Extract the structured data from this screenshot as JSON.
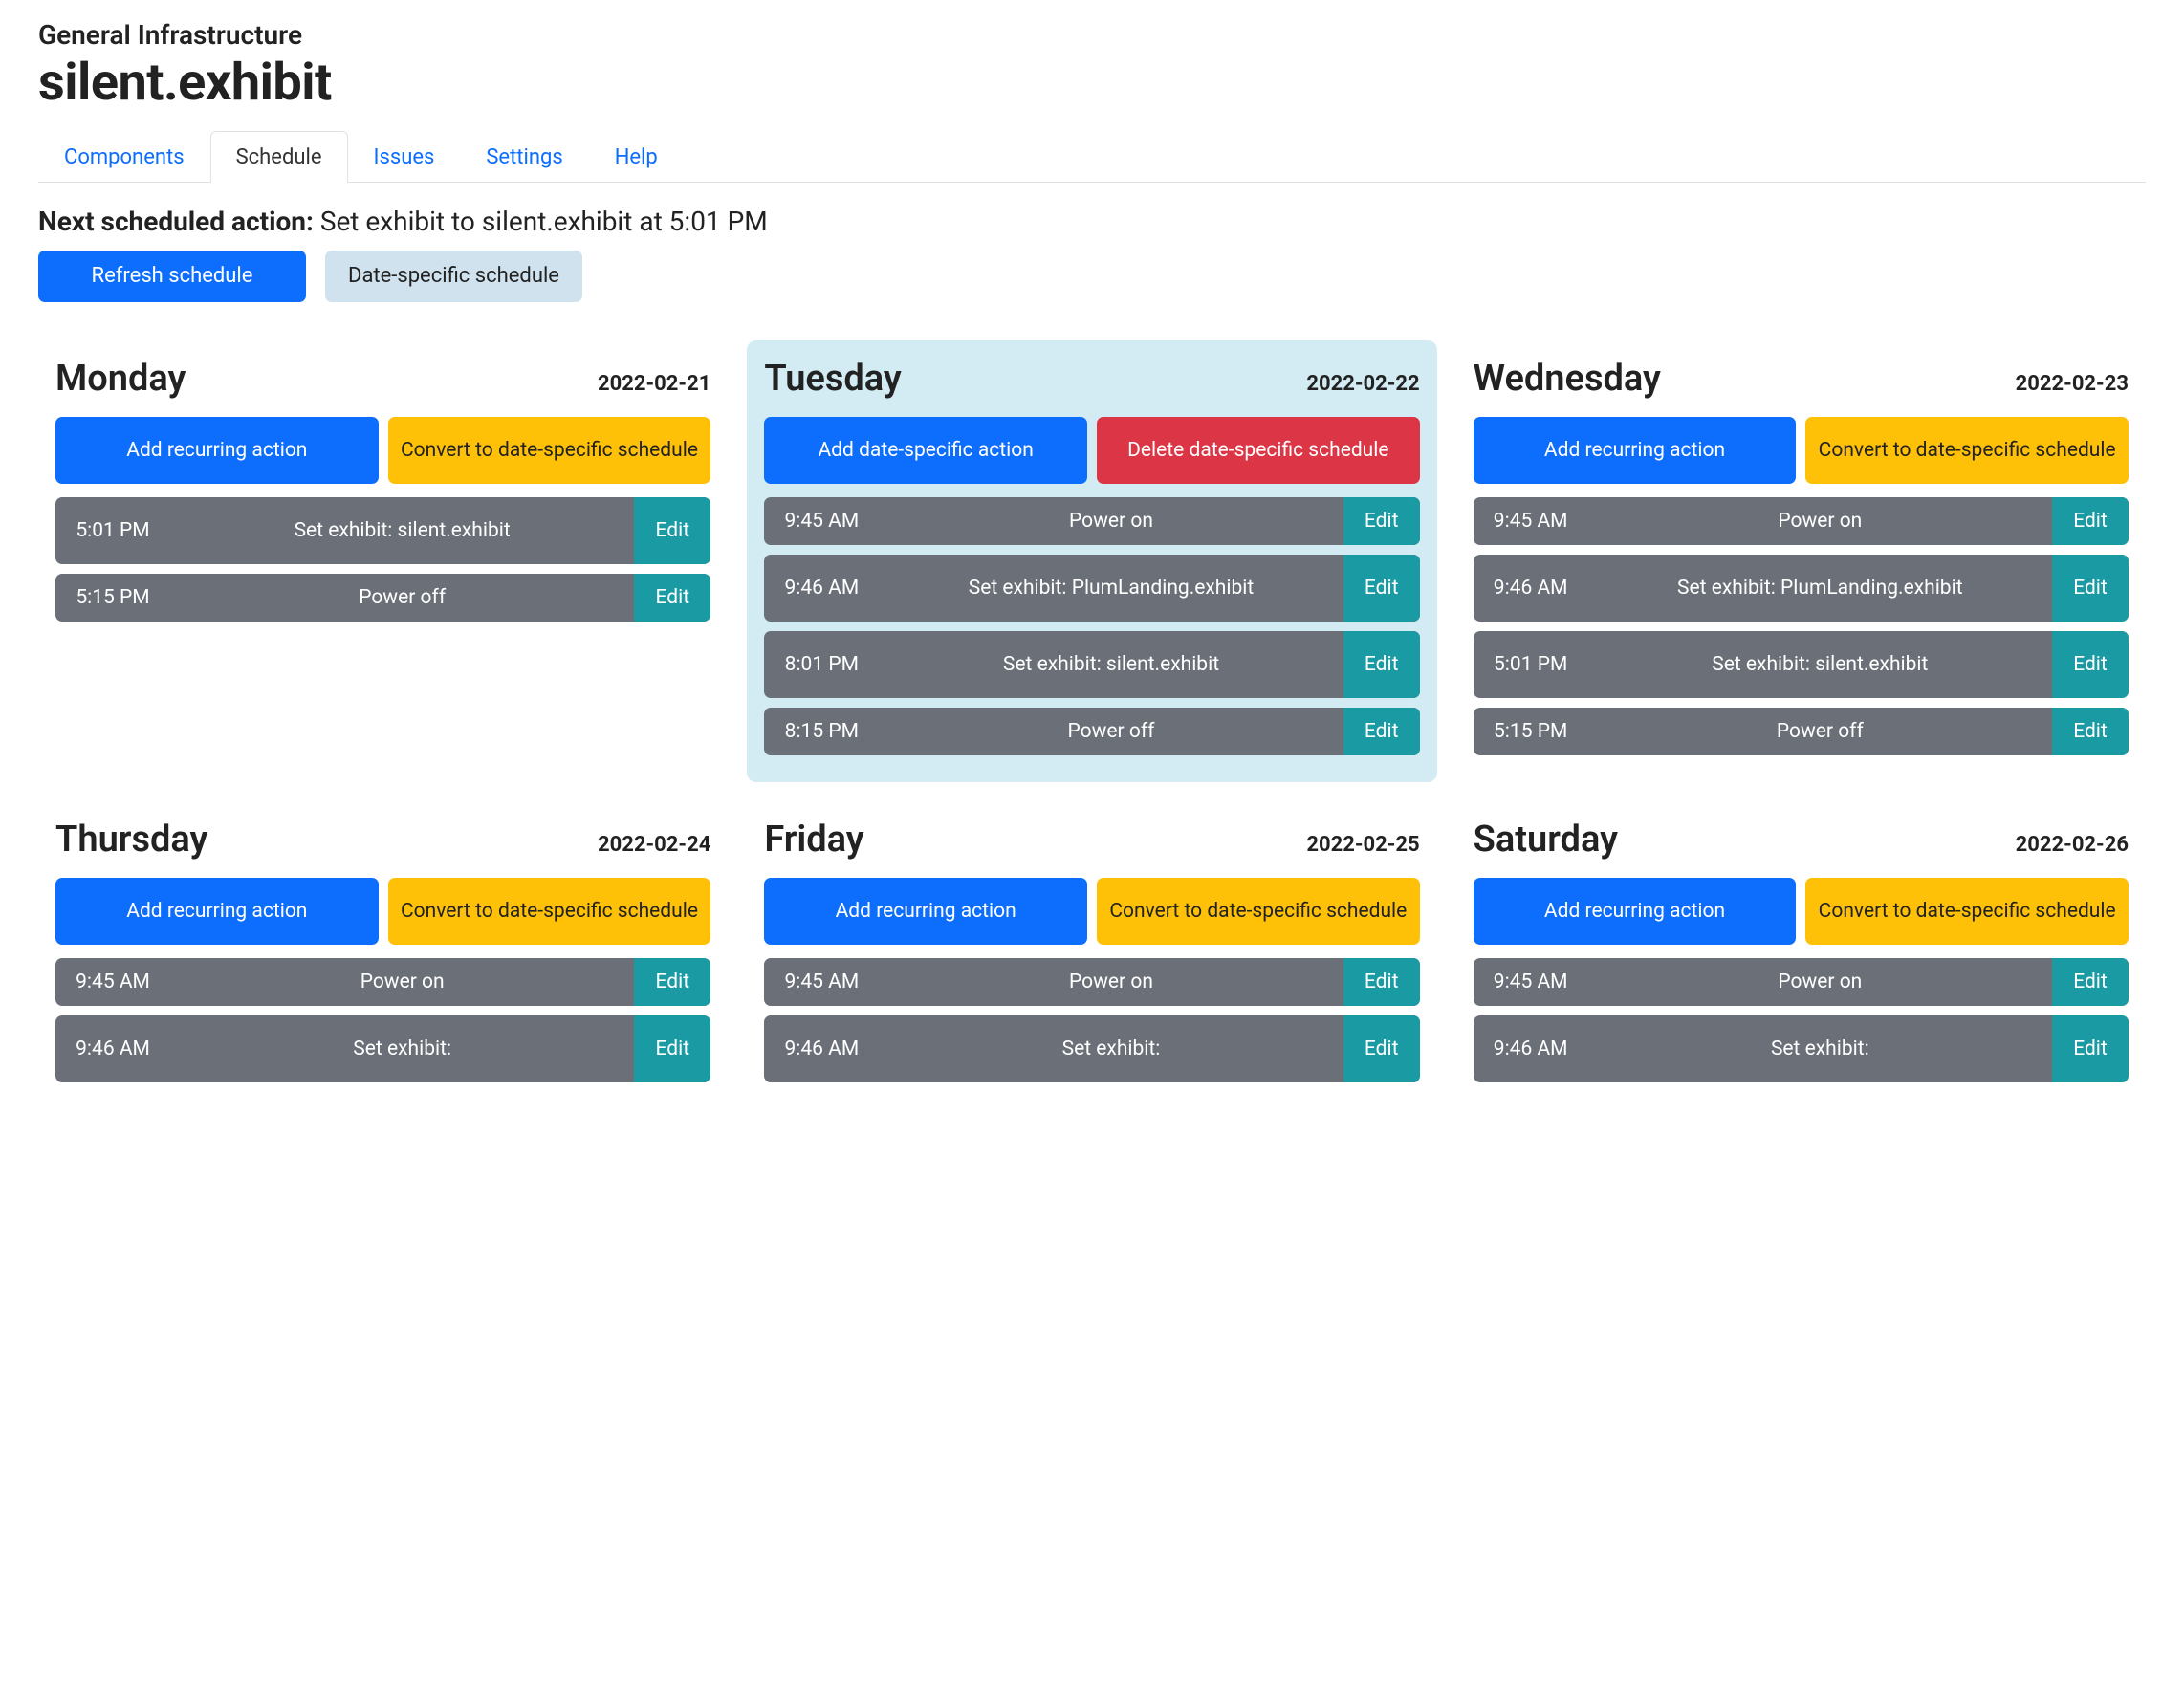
{
  "breadcrumb": "General Infrastructure",
  "title": "silent.exhibit",
  "tabs": [
    {
      "label": "Components",
      "active": false
    },
    {
      "label": "Schedule",
      "active": true
    },
    {
      "label": "Issues",
      "active": false
    },
    {
      "label": "Settings",
      "active": false
    },
    {
      "label": "Help",
      "active": false
    }
  ],
  "next_action": {
    "label": "Next scheduled action:",
    "text": "Set exhibit to silent.exhibit at 5:01 PM"
  },
  "top_buttons": {
    "refresh": "Refresh schedule",
    "date_specific": "Date-specific schedule"
  },
  "button_labels": {
    "add_recurring": "Add recurring action",
    "convert": "Convert to date-specific schedule",
    "add_date_specific": "Add date-specific action",
    "delete_date_specific": "Delete date-specific schedule",
    "edit": "Edit"
  },
  "days": [
    {
      "name": "Monday",
      "date": "2022-02-21",
      "highlight": false,
      "btn_left": {
        "style": "primary",
        "text_key": "add_recurring"
      },
      "btn_right": {
        "style": "yellow",
        "text_key": "convert"
      },
      "actions": [
        {
          "time": "5:01 PM",
          "desc": "Set exhibit: silent.exhibit",
          "tall": true
        },
        {
          "time": "5:15 PM",
          "desc": "Power off",
          "tall": false
        }
      ]
    },
    {
      "name": "Tuesday",
      "date": "2022-02-22",
      "highlight": true,
      "btn_left": {
        "style": "primary",
        "text_key": "add_date_specific"
      },
      "btn_right": {
        "style": "red",
        "text_key": "delete_date_specific"
      },
      "actions": [
        {
          "time": "9:45 AM",
          "desc": "Power on",
          "tall": false
        },
        {
          "time": "9:46 AM",
          "desc": "Set exhibit: PlumLanding.exhibit",
          "tall": true
        },
        {
          "time": "8:01 PM",
          "desc": "Set exhibit: silent.exhibit",
          "tall": true
        },
        {
          "time": "8:15 PM",
          "desc": "Power off",
          "tall": false
        }
      ]
    },
    {
      "name": "Wednesday",
      "date": "2022-02-23",
      "highlight": false,
      "btn_left": {
        "style": "primary",
        "text_key": "add_recurring"
      },
      "btn_right": {
        "style": "yellow",
        "text_key": "convert"
      },
      "actions": [
        {
          "time": "9:45 AM",
          "desc": "Power on",
          "tall": false
        },
        {
          "time": "9:46 AM",
          "desc": "Set exhibit: PlumLanding.exhibit",
          "tall": true
        },
        {
          "time": "5:01 PM",
          "desc": "Set exhibit: silent.exhibit",
          "tall": true
        },
        {
          "time": "5:15 PM",
          "desc": "Power off",
          "tall": false
        }
      ]
    },
    {
      "name": "Thursday",
      "date": "2022-02-24",
      "highlight": false,
      "btn_left": {
        "style": "primary",
        "text_key": "add_recurring"
      },
      "btn_right": {
        "style": "yellow",
        "text_key": "convert"
      },
      "actions": [
        {
          "time": "9:45 AM",
          "desc": "Power on",
          "tall": false
        },
        {
          "time": "9:46 AM",
          "desc": "Set exhibit:",
          "tall": true
        }
      ]
    },
    {
      "name": "Friday",
      "date": "2022-02-25",
      "highlight": false,
      "btn_left": {
        "style": "primary",
        "text_key": "add_recurring"
      },
      "btn_right": {
        "style": "yellow",
        "text_key": "convert"
      },
      "actions": [
        {
          "time": "9:45 AM",
          "desc": "Power on",
          "tall": false
        },
        {
          "time": "9:46 AM",
          "desc": "Set exhibit:",
          "tall": true
        }
      ]
    },
    {
      "name": "Saturday",
      "date": "2022-02-26",
      "highlight": false,
      "btn_left": {
        "style": "primary",
        "text_key": "add_recurring"
      },
      "btn_right": {
        "style": "yellow",
        "text_key": "convert"
      },
      "actions": [
        {
          "time": "9:45 AM",
          "desc": "Power on",
          "tall": false
        },
        {
          "time": "9:46 AM",
          "desc": "Set exhibit:",
          "tall": true
        }
      ]
    }
  ]
}
